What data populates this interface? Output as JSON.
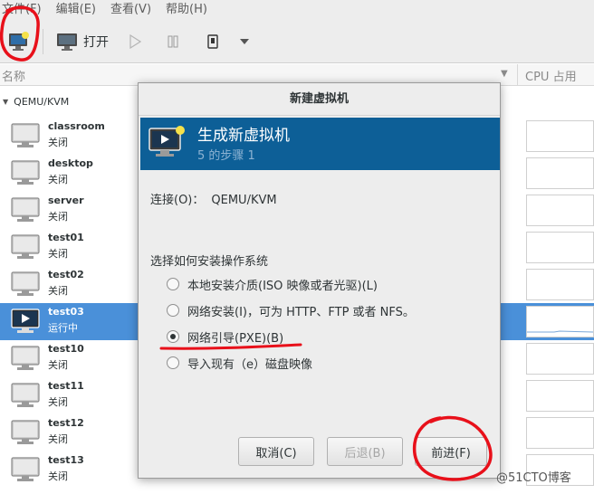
{
  "menu": [
    "文件(F)",
    "编辑(E)",
    "查看(V)",
    "帮助(H)"
  ],
  "toolbar": {
    "open_label": "打开",
    "new_icon": "new-vm-icon",
    "open_icon": "monitor-icon"
  },
  "list_header": {
    "name": "名称",
    "cpu": "CPU 占用"
  },
  "group": "QEMU/KVM",
  "vms": [
    {
      "name": "classroom",
      "status": "关闭"
    },
    {
      "name": "desktop",
      "status": "关闭"
    },
    {
      "name": "server",
      "status": "关闭"
    },
    {
      "name": "test01",
      "status": "关闭"
    },
    {
      "name": "test02",
      "status": "关闭"
    },
    {
      "name": "test03",
      "status": "运行中"
    },
    {
      "name": "test10",
      "status": "关闭"
    },
    {
      "name": "test11",
      "status": "关闭"
    },
    {
      "name": "test12",
      "status": "关闭"
    },
    {
      "name": "test13",
      "status": "关闭"
    }
  ],
  "dialog": {
    "title": "新建虚拟机",
    "banner_title": "生成新虚拟机",
    "banner_step": "5 的步骤 1",
    "connection_label": "连接(O)：",
    "connection_value": "QEMU/KVM",
    "prompt": "选择如何安装操作系统",
    "options": [
      "本地安装介质(ISO 映像或者光驱)(L)",
      "网络安装(I)，可为 HTTP、FTP 或者 NFS。",
      "网络引导(PXE)(B)",
      "导入现有（e）磁盘映像"
    ],
    "selected_option": 2,
    "buttons": {
      "cancel": "取消(C)",
      "back": "后退(B)",
      "forward": "前进(F)"
    }
  },
  "watermark": "@51CTO博客",
  "colors": {
    "selection": "#4a90d9",
    "banner": "#0d5f97",
    "annotation": "#e8101a"
  }
}
